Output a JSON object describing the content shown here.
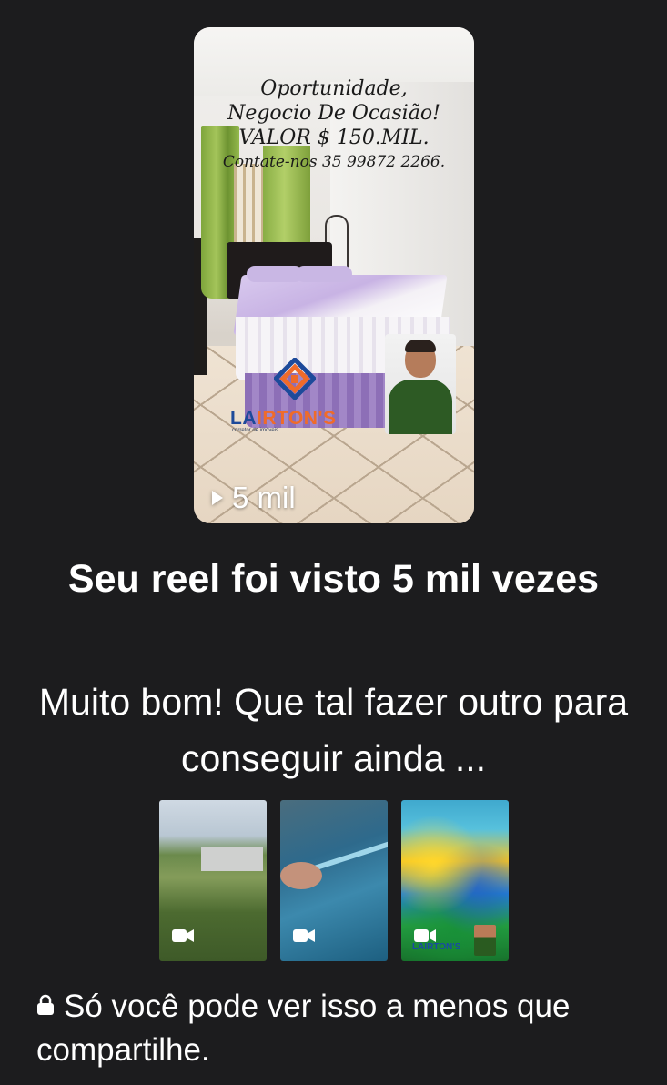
{
  "reel": {
    "overlay_lines": [
      "Oportunidade,",
      "Negocio De Ocasião!",
      "VALOR $ 150.MIL.",
      "Contate-nos 35 99872 2266."
    ],
    "brand": {
      "name_prefix": "LA",
      "name_mid": "IRTON",
      "name_suffix": "'S",
      "tagline": "corretor de imóveis"
    },
    "views_label": "5 mil",
    "icons": {
      "play": "play-icon",
      "logo": "house-logo-icon"
    }
  },
  "headline": "Seu reel foi visto 5 mil vezes",
  "subtext": "Muito bom! Que tal fazer outro para conseguir ainda ...",
  "thumbnails": [
    {
      "icon": "video-camera-icon"
    },
    {
      "icon": "video-camera-icon"
    },
    {
      "icon": "video-camera-icon",
      "brand": "LAIRTON'S"
    }
  ],
  "privacy": {
    "icon": "lock-icon",
    "text": "Só você pode ver isso a menos que compartilhe."
  },
  "colors": {
    "background": "#1c1c1e",
    "text": "#ffffff",
    "brand_blue": "#1d4a9a",
    "brand_orange": "#ef6b2a"
  }
}
